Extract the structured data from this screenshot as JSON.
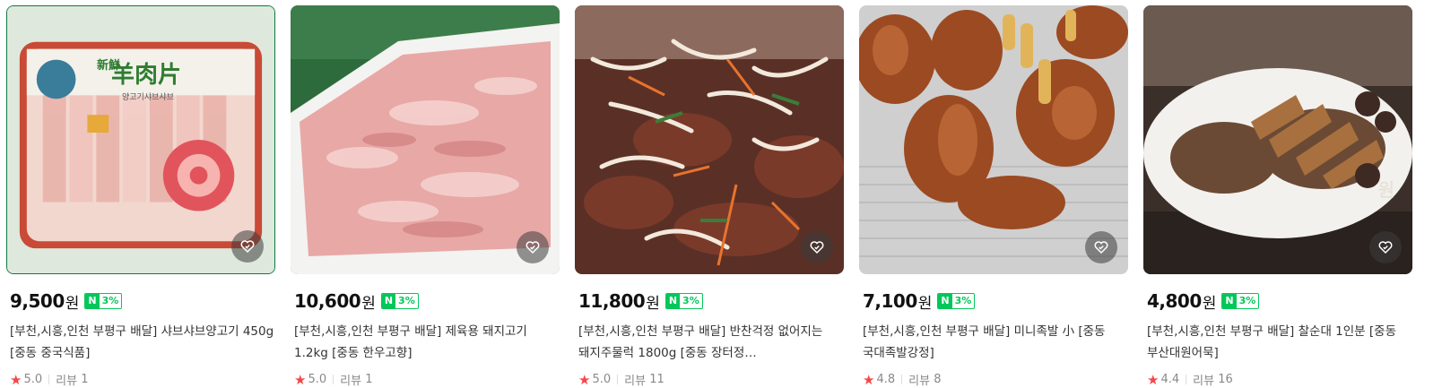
{
  "products": [
    {
      "price": "9,500",
      "won": "원",
      "npay": "3%",
      "title": "[부천,시흥,인천 부평구 배달] 샤브샤브양고기 450g [중동 중국식품]",
      "rating": "5.0",
      "review_label": "리뷰",
      "review_count": "1",
      "image": "lamb-slice-package",
      "image_text_main": "羊肉片",
      "image_text_small": "新鮮",
      "image_text_sub": "양고기샤브샤브"
    },
    {
      "price": "10,600",
      "won": "원",
      "npay": "3%",
      "title": "[부천,시흥,인천 부평구 배달] 제육용 돼지고기 1.2kg [중동 한우고향]",
      "rating": "5.0",
      "review_label": "리뷰",
      "review_count": "1",
      "image": "raw-pork-tray"
    },
    {
      "price": "11,800",
      "won": "원",
      "npay": "3%",
      "title": "[부천,시흥,인천 부평구 배달] 반찬걱정 없어지는 돼지주물럭 1800g [중동 장터정…",
      "rating": "5.0",
      "review_label": "리뷰",
      "review_count": "11",
      "image": "marinated-pork"
    },
    {
      "price": "7,100",
      "won": "원",
      "npay": "3%",
      "title": "[부천,시흥,인천 부평구 배달] 미니족발 小 [중동 국대족발강정]",
      "rating": "4.8",
      "review_label": "리뷰",
      "review_count": "8",
      "image": "pig-trotters"
    },
    {
      "price": "4,800",
      "won": "원",
      "npay": "3%",
      "title": "[부천,시흥,인천 부평구 배달] 찰순대 1인분 [중동 부산대원어묵]",
      "rating": "4.4",
      "review_label": "리뷰",
      "review_count": "16",
      "image": "sundae-plate",
      "image_text_main": "원"
    }
  ],
  "colors": {
    "npay_green": "#03c75a",
    "star_red": "#f5464a",
    "text": "#333333"
  },
  "icons": {
    "wishlist": "heart-check-icon",
    "rating": "star-icon",
    "npay": "naver-pay-icon"
  }
}
